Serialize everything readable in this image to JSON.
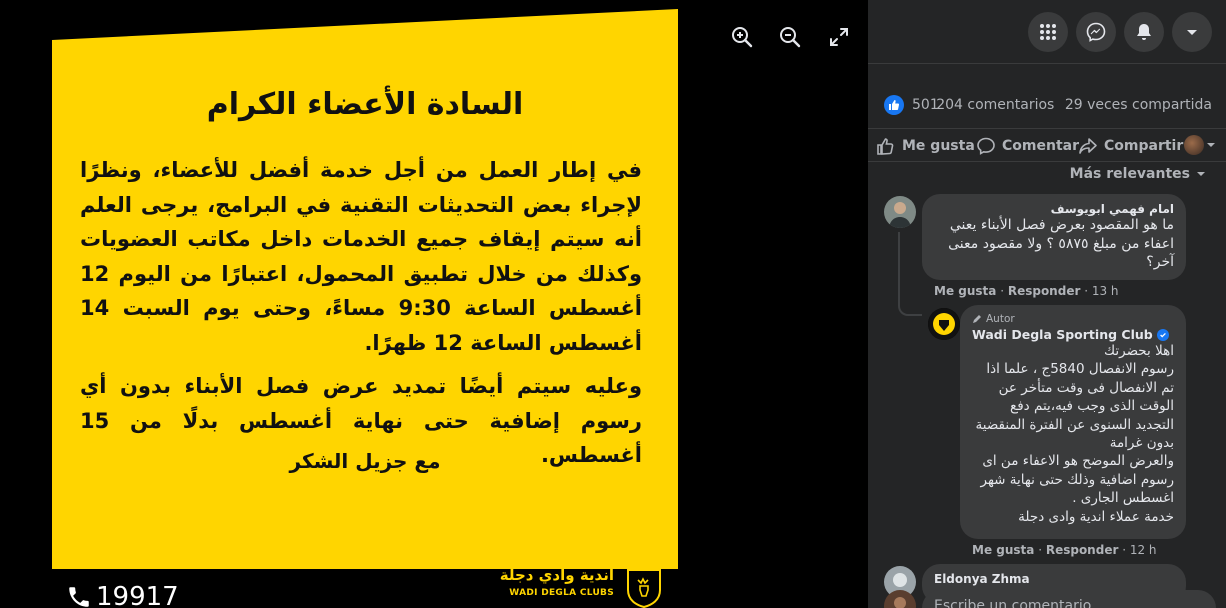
{
  "poster": {
    "title": "السادة الأعضاء الكرام",
    "paragraph1": "في إطار العمل من أجل خدمة أفضل للأعضاء، ونظرًا لإجراء بعض التحديثات التقنية في البرامج، يرجى العلم أنه سيتم إيقاف جميع الخدمات داخل مكاتب العضويات وكذلك من خلال تطبيق المحمول، اعتبارًا من اليوم 12 أغسطس الساعة 9:30 مساءً، وحتى يوم السبت 14 أغسطس الساعة 12 ظهرًا.",
    "paragraph2": "وعليه سيتم أيضًا تمديد عرض فصل الأبناء بدون أي رسوم إضافية حتى نهاية أغسطس بدلًا من 15 أغسطس.",
    "closing": "مع جزيل الشكر",
    "brand_ar": "أندية وادي دجلة",
    "brand_en": "WADI DEGLA CLUBS",
    "hotline": "19917",
    "bg_color": "#ffd500"
  },
  "viewer": {
    "zoom_in_icon": "zoom-in-icon",
    "zoom_out_icon": "zoom-out-icon",
    "fullscreen_icon": "fullscreen-icon"
  },
  "topbar": {
    "icons": [
      "menu-grid-icon",
      "messenger-icon",
      "notifications-icon",
      "account-chevron-icon"
    ]
  },
  "stats": {
    "likes": "501",
    "comments": "204 comentarios",
    "shares": "29 veces compartida"
  },
  "actions": {
    "like": "Me gusta",
    "comment": "Comentar",
    "share": "Compartir"
  },
  "sort_label": "Más relevantes",
  "comments": [
    {
      "author": "امام فهمي ابويوسف",
      "text": "ما هو المقصود بعرض فصل الأبناء يعني اعفاء من مبلغ ٥٨٧٥ ؟ ولا مقصود معنى آخر؟",
      "like": "Me gusta",
      "reply": "Responder",
      "time": "13 h"
    },
    {
      "author_tag": "Autor",
      "author": "Wadi Degla Sporting Club",
      "text": "اهلا بحضرتك\nرسوم الانفصال 5840ج ، علما اذا تم الانفصال فى وقت متأخر عن الوقت الذى وجب فيه،يتم دفع التجديد السنوى عن الفترة المنقضية بدون غرامة\nوالعرض الموضح هو الاعفاء من اى رسوم اضافية وذلك حتى نهاية شهر اغسطس الجارى .\nخدمة عملاء اندية وادى دجلة",
      "like": "Me gusta",
      "reply": "Responder",
      "time": "12 h"
    },
    {
      "author": "Eldonya Zhma"
    }
  ],
  "composer": {
    "placeholder": "Escribe un comentario..."
  }
}
